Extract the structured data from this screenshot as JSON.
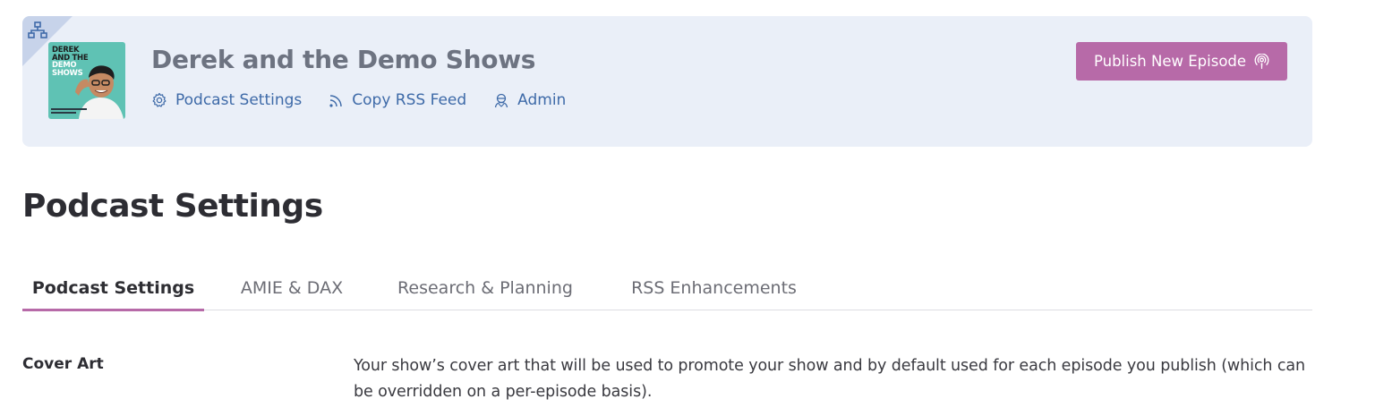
{
  "header": {
    "network_icon": "network-icon",
    "cover": {
      "line1": "DEREK",
      "line2": "AND THE",
      "line3": "DEMO",
      "line4": "SHOWS"
    },
    "show_title": "Derek and the Demo Shows",
    "links": [
      {
        "label": "Podcast Settings",
        "icon": "gear-icon"
      },
      {
        "label": "Copy RSS Feed",
        "icon": "rss-icon"
      },
      {
        "label": "Admin",
        "icon": "admin-icon"
      }
    ],
    "publish_button": {
      "label": "Publish New Episode",
      "icon": "podcast-icon"
    }
  },
  "page": {
    "title": "Podcast Settings"
  },
  "tabs": [
    {
      "label": "Podcast Settings",
      "active": true
    },
    {
      "label": "AMIE & DAX",
      "active": false
    },
    {
      "label": "Research & Planning",
      "active": false
    },
    {
      "label": "RSS Enhancements",
      "active": false
    }
  ],
  "fields": [
    {
      "label": "Cover Art",
      "description": "Your show’s cover art that will be used to promote your show and by default used for each episode you publish (which can be overridden on a per-episode basis)."
    }
  ],
  "colors": {
    "accent": "#b76aa8",
    "link": "#3e6aa8",
    "header_bg": "#eaeff8",
    "cover_bg": "#5fc2b4"
  }
}
